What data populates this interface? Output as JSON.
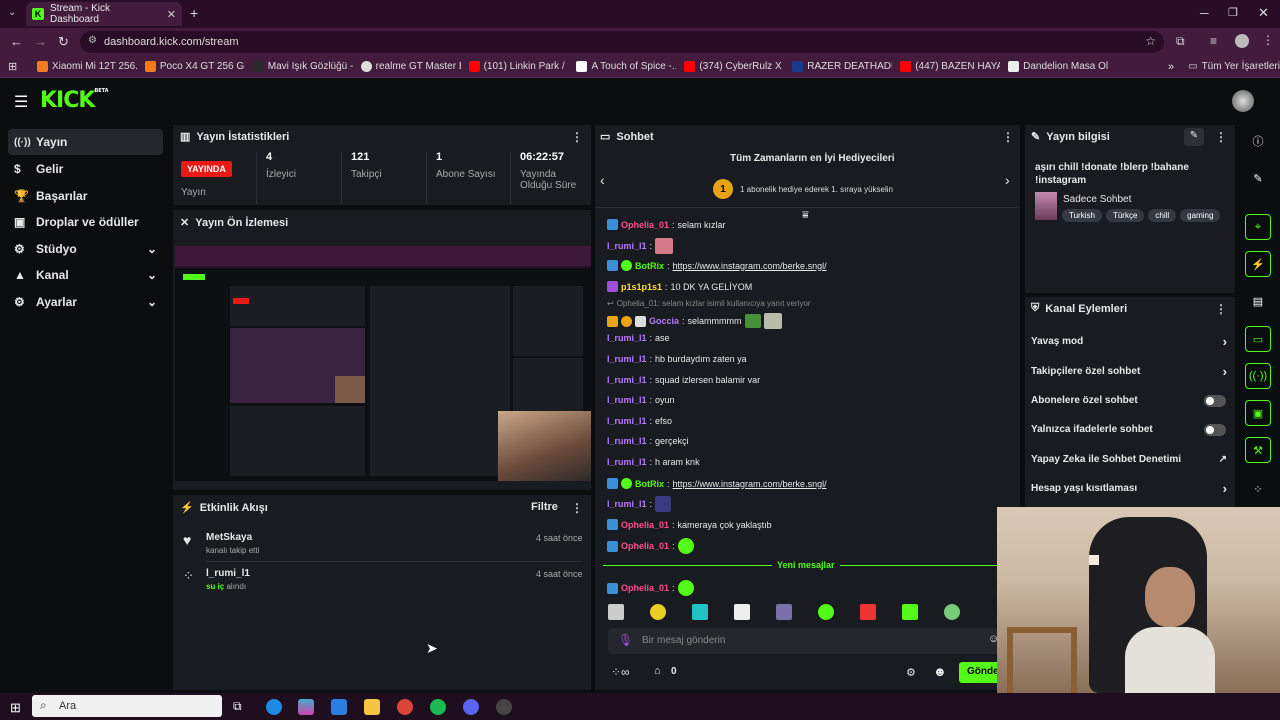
{
  "browser": {
    "tab_title": "Stream - Kick Dashboard",
    "url": "dashboard.kick.com/stream",
    "bookmarks": [
      "Xiaomi Mi 12T 256...",
      "Poco X4 GT 256 GB...",
      "Mavi Işık Gözlüğü -...",
      "realme GT Master E...",
      "(101) Linkin Park / S...",
      "A Touch of Spice -...",
      "(374) CyberRulz X B...",
      "RAZER DEATHADDE...",
      "(447) BAZEN HAYAT...",
      "Dandelion Masa Oli..."
    ],
    "all_bookmarks": "Tüm Yer İşaretleri"
  },
  "logo": {
    "text": "KICK",
    "beta": "BETA"
  },
  "sidebar": {
    "items": [
      {
        "label": "Yayın",
        "icon": "broadcast-icon"
      },
      {
        "label": "Gelir",
        "icon": "dollar-icon"
      },
      {
        "label": "Başarılar",
        "icon": "trophy-icon"
      },
      {
        "label": "Droplar ve ödüller",
        "icon": "gift-icon"
      },
      {
        "label": "Stüdyo",
        "icon": "studio-icon"
      },
      {
        "label": "Kanal",
        "icon": "channel-icon"
      },
      {
        "label": "Ayarlar",
        "icon": "gear-icon"
      }
    ]
  },
  "stats": {
    "title": "Yayın İstatistikleri",
    "live_badge": "YAYINDA",
    "live_label": "Yayın",
    "viewers": "4",
    "viewers_label": "İzleyici",
    "followers": "121",
    "followers_label": "Takipçi",
    "subs": "1",
    "subs_label": "Abone Sayısı",
    "uptime": "06:22:57",
    "uptime_label": "Yayında Olduğu Süre"
  },
  "preview": {
    "title": "Yayın Ön İzlemesi"
  },
  "activity": {
    "title": "Etkinlik Akışı",
    "filter": "Filtre",
    "items": [
      {
        "user": "MetSkaya",
        "action": "kanalı takip etti",
        "time": "4 saat önce"
      },
      {
        "user": "l_rumi_l1",
        "action_highlight": "su iç",
        "action": "alındı",
        "time": "4 saat önce"
      }
    ]
  },
  "chat": {
    "title": "Sohbet",
    "gifters_title": "Tüm Zamanların en İyi Hediyecileri",
    "gifters_rank": "1",
    "gifters_sub": "1 abonelik hediye ederek 1. sıraya yükselin",
    "messages": [
      {
        "user": "Ophelia_01",
        "text": "selam kızlar",
        "color": "#ff4f8b"
      },
      {
        "user": "l_rumi_l1",
        "text": "",
        "color": "#b77bff"
      },
      {
        "user": "BotRix",
        "text": "https://www.instagram.com/berke.sngl/",
        "color": "#53fc18"
      },
      {
        "user": "p1s1p1s1",
        "text": "10 DK YA GELİYOM",
        "color": "#ffde3b"
      },
      {
        "user": "",
        "text": "Ophelia_01: selam kızlar isimli kullanıcıya yanıt veriyor",
        "color": "#888"
      },
      {
        "user": "Goccia",
        "text": "selammmmm",
        "color": "#b77bff"
      },
      {
        "user": "l_rumi_l1",
        "text": "ase",
        "color": "#b77bff"
      },
      {
        "user": "l_rumi_l1",
        "text": "hb burdaydım zaten ya",
        "color": "#b77bff"
      },
      {
        "user": "l_rumi_l1",
        "text": "squad izlersen balamir var",
        "color": "#b77bff"
      },
      {
        "user": "l_rumi_l1",
        "text": "oyun",
        "color": "#b77bff"
      },
      {
        "user": "l_rumi_l1",
        "text": "efso",
        "color": "#b77bff"
      },
      {
        "user": "l_rumi_l1",
        "text": "gerçekçi",
        "color": "#b77bff"
      },
      {
        "user": "l_rumi_l1",
        "text": "h aram knk",
        "color": "#b77bff"
      },
      {
        "user": "BotRix",
        "text": "https://www.instagram.com/berke.sngl/",
        "color": "#53fc18"
      },
      {
        "user": "l_rumi_l1",
        "text": "",
        "color": "#b77bff"
      },
      {
        "user": "Ophelia_01",
        "text": "kameraya çok yaklaştıb",
        "color": "#ff4f8b"
      },
      {
        "user": "Ophelia_01",
        "text": "",
        "color": "#ff4f8b"
      }
    ],
    "new_messages": "Yeni mesajlar",
    "last": {
      "user": "Ophelia_01",
      "text": ""
    },
    "input_placeholder": "Bir mesaj gönderin",
    "points": "0",
    "send": "Gönder"
  },
  "stream_info": {
    "title": "Yayın bilgisi",
    "stream_title": "aşırı chill !donate !blerp !bahane !instagram",
    "category": "Sadece Sohbet",
    "tags": [
      "Turkish",
      "Türkçe",
      "chill",
      "gaming"
    ]
  },
  "channel_actions": {
    "title": "Kanal Eylemleri",
    "items": [
      {
        "label": "Yavaş mod",
        "control": "arrow"
      },
      {
        "label": "Takipçilere özel sohbet",
        "control": "arrow"
      },
      {
        "label": "Abonelere özel sohbet",
        "control": "toggle",
        "on": false
      },
      {
        "label": "Yalnızca ifadelerle sohbet",
        "control": "toggle",
        "on": false
      },
      {
        "label": "Yapay Zeka ile Sohbet Denetimi",
        "control": "external"
      },
      {
        "label": "Hesap yaşı kısıtlaması",
        "control": "arrow"
      }
    ]
  },
  "taskbar": {
    "search": "Ara"
  },
  "colors": {
    "accent": "#53fc18",
    "live": "#e91916",
    "panel": "#181b1f",
    "bg": "#0b0e0f"
  }
}
